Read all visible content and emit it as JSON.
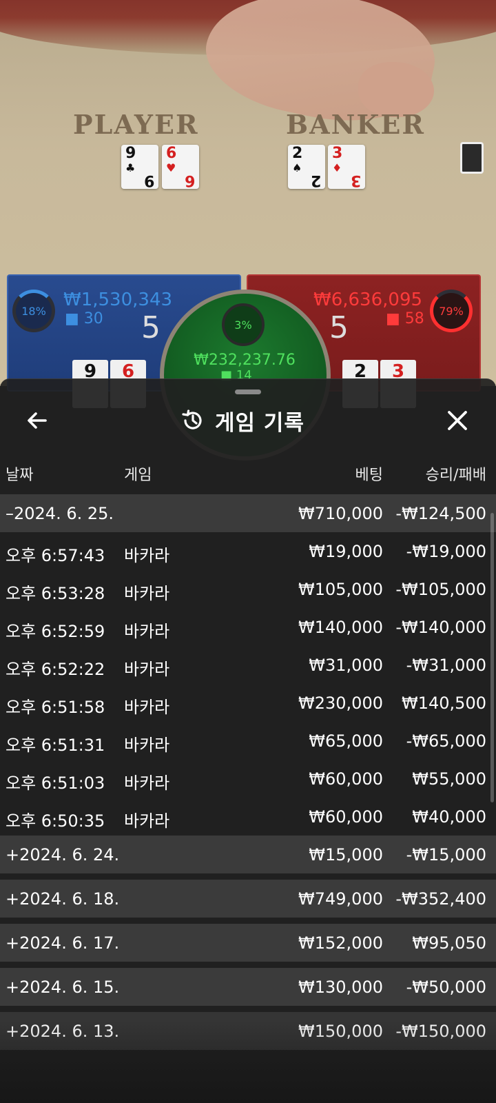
{
  "game_scene": {
    "player_label": "PLAYER",
    "banker_label": "BANKER",
    "player_cards": [
      {
        "rank": "9",
        "suit": "♣",
        "color": "black"
      },
      {
        "rank": "6",
        "suit": "♥",
        "color": "red"
      }
    ],
    "banker_cards": [
      {
        "rank": "2",
        "suit": "♠",
        "color": "black"
      },
      {
        "rank": "3",
        "suit": "♦",
        "color": "red"
      }
    ],
    "player_panel": {
      "percent": "18%",
      "amount": "₩1,530,343",
      "people": "30",
      "score": "5"
    },
    "banker_panel": {
      "percent": "79%",
      "amount": "₩6,636,095",
      "people": "58",
      "score": "5"
    },
    "tie_panel": {
      "percent": "3%",
      "amount": "₩232,237.76",
      "people": "14"
    }
  },
  "sheet": {
    "title": "게임 기록",
    "columns": {
      "date": "날짜",
      "game": "게임",
      "bet": "베팅",
      "win_loss": "승리/패배"
    },
    "groups": [
      {
        "date": "–2024. 6. 25.",
        "bet": "₩710,000",
        "win_loss": "-₩124,500",
        "expanded": true,
        "items": [
          {
            "time": "오후 6:57:43",
            "game": "바카라",
            "bet": "₩19,000",
            "win_loss": "-₩19,000"
          },
          {
            "time": "오후 6:53:28",
            "game": "바카라",
            "bet": "₩105,000",
            "win_loss": "-₩105,000"
          },
          {
            "time": "오후 6:52:59",
            "game": "바카라",
            "bet": "₩140,000",
            "win_loss": "-₩140,000"
          },
          {
            "time": "오후 6:52:22",
            "game": "바카라",
            "bet": "₩31,000",
            "win_loss": "-₩31,000"
          },
          {
            "time": "오후 6:51:58",
            "game": "바카라",
            "bet": "₩230,000",
            "win_loss": "₩140,500"
          },
          {
            "time": "오후 6:51:31",
            "game": "바카라",
            "bet": "₩65,000",
            "win_loss": "-₩65,000"
          },
          {
            "time": "오후 6:51:03",
            "game": "바카라",
            "bet": "₩60,000",
            "win_loss": "₩55,000"
          },
          {
            "time": "오후 6:50:35",
            "game": "바카라",
            "bet": "₩60,000",
            "win_loss": "₩40,000"
          }
        ]
      },
      {
        "date": "+2024. 6. 24.",
        "bet": "₩15,000",
        "win_loss": "-₩15,000",
        "expanded": false,
        "items": []
      },
      {
        "date": "+2024. 6. 18.",
        "bet": "₩749,000",
        "win_loss": "-₩352,400",
        "expanded": false,
        "items": []
      },
      {
        "date": "+2024. 6. 17.",
        "bet": "₩152,000",
        "win_loss": "₩95,050",
        "expanded": false,
        "items": []
      },
      {
        "date": "+2024. 6. 15.",
        "bet": "₩130,000",
        "win_loss": "-₩50,000",
        "expanded": false,
        "items": []
      },
      {
        "date": "+2024. 6. 13.",
        "bet": "₩150,000",
        "win_loss": "-₩150,000",
        "expanded": false,
        "items": []
      }
    ]
  }
}
